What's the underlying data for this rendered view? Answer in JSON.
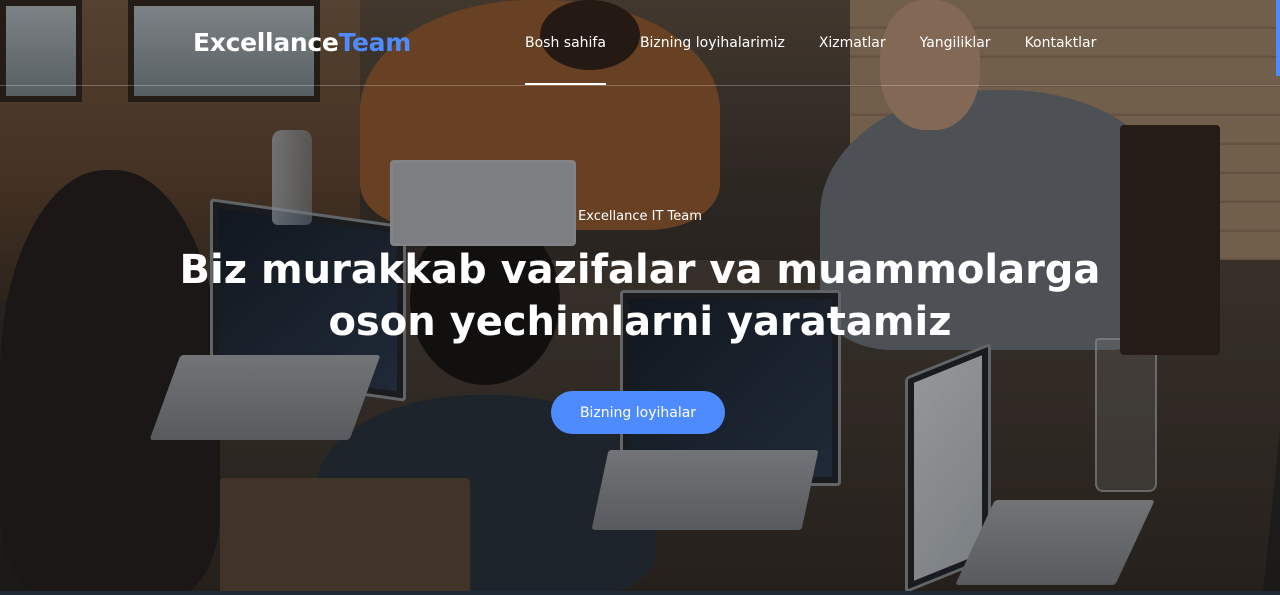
{
  "brand": {
    "logo_main": "Excellance",
    "logo_accent": "Team",
    "accent_color": "#4d8bff"
  },
  "nav": {
    "items": [
      {
        "label": "Bosh sahifa",
        "active": true
      },
      {
        "label": "Bizning loyihalarimiz",
        "active": false
      },
      {
        "label": "Xizmatlar",
        "active": false
      },
      {
        "label": "Yangiliklar",
        "active": false
      },
      {
        "label": "Kontaktlar",
        "active": false
      }
    ]
  },
  "hero": {
    "eyebrow": "Excellance IT Team",
    "headline_line1": "Biz murakkab vazifalar va muammolarga",
    "headline_line2": "oson yechimlarni yaratamiz",
    "cta_label": "Bizning loyihalar",
    "background_image": "team-working-on-laptops-photo"
  }
}
